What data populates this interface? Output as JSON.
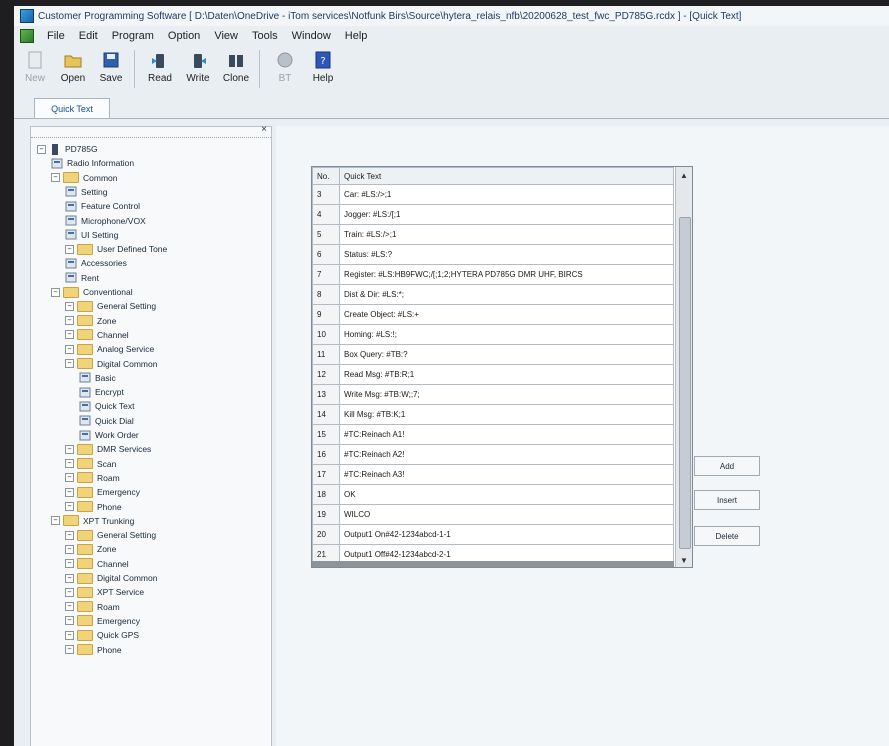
{
  "window": {
    "title": "Customer Programming Software [ D:\\Daten\\OneDrive - iTom services\\Notfunk Birs\\Source\\hytera_relais_nfb\\20200628_test_fwc_PD785G.rcdx ] - [Quick Text]"
  },
  "menu": [
    "File",
    "Edit",
    "Program",
    "Option",
    "View",
    "Tools",
    "Window",
    "Help"
  ],
  "toolbar": {
    "new": "New",
    "open": "Open",
    "save": "Save",
    "read": "Read",
    "write": "Write",
    "clone": "Clone",
    "bt": "BT",
    "help": "Help"
  },
  "tab": {
    "label": "Quick Text"
  },
  "tree": [
    {
      "label": "PD785G",
      "level": 0,
      "kind": "device"
    },
    {
      "label": "Radio Information",
      "level": 1,
      "kind": "leaf"
    },
    {
      "label": "Common",
      "level": 1,
      "kind": "folder"
    },
    {
      "label": "Setting",
      "level": 2,
      "kind": "leaf"
    },
    {
      "label": "Feature Control",
      "level": 2,
      "kind": "leaf"
    },
    {
      "label": "Microphone/VOX",
      "level": 2,
      "kind": "leaf"
    },
    {
      "label": "UI Setting",
      "level": 2,
      "kind": "leaf"
    },
    {
      "label": "User Defined Tone",
      "level": 2,
      "kind": "folder"
    },
    {
      "label": "Accessories",
      "level": 2,
      "kind": "leaf"
    },
    {
      "label": "Rent",
      "level": 2,
      "kind": "leaf"
    },
    {
      "label": "Conventional",
      "level": 1,
      "kind": "folder"
    },
    {
      "label": "General Setting",
      "level": 2,
      "kind": "folder"
    },
    {
      "label": "Zone",
      "level": 2,
      "kind": "folder"
    },
    {
      "label": "Channel",
      "level": 2,
      "kind": "folder"
    },
    {
      "label": "Analog Service",
      "level": 2,
      "kind": "folder"
    },
    {
      "label": "Digital Common",
      "level": 2,
      "kind": "folder"
    },
    {
      "label": "Basic",
      "level": 3,
      "kind": "leaf"
    },
    {
      "label": "Encrypt",
      "level": 3,
      "kind": "leaf"
    },
    {
      "label": "Quick Text",
      "level": 3,
      "kind": "leaf"
    },
    {
      "label": "Quick Dial",
      "level": 3,
      "kind": "leaf"
    },
    {
      "label": "Work Order",
      "level": 3,
      "kind": "leaf"
    },
    {
      "label": "DMR Services",
      "level": 2,
      "kind": "folder"
    },
    {
      "label": "Scan",
      "level": 2,
      "kind": "folder"
    },
    {
      "label": "Roam",
      "level": 2,
      "kind": "folder"
    },
    {
      "label": "Emergency",
      "level": 2,
      "kind": "folder"
    },
    {
      "label": "Phone",
      "level": 2,
      "kind": "folder"
    },
    {
      "label": "XPT Trunking",
      "level": 1,
      "kind": "folder"
    },
    {
      "label": "General Setting",
      "level": 2,
      "kind": "folder"
    },
    {
      "label": "Zone",
      "level": 2,
      "kind": "folder"
    },
    {
      "label": "Channel",
      "level": 2,
      "kind": "folder"
    },
    {
      "label": "Digital Common",
      "level": 2,
      "kind": "folder"
    },
    {
      "label": "XPT Service",
      "level": 2,
      "kind": "folder"
    },
    {
      "label": "Roam",
      "level": 2,
      "kind": "folder"
    },
    {
      "label": "Emergency",
      "level": 2,
      "kind": "folder"
    },
    {
      "label": "Quick GPS",
      "level": 2,
      "kind": "folder"
    },
    {
      "label": "Phone",
      "level": 2,
      "kind": "folder"
    }
  ],
  "grid": {
    "headers": [
      "No.",
      "Quick Text"
    ],
    "rows": [
      [
        "3",
        "Car: #LS:/>;1"
      ],
      [
        "4",
        "Jogger: #LS:/[;1"
      ],
      [
        "5",
        "Train: #LS:/>;1"
      ],
      [
        "6",
        "Status: #LS:?"
      ],
      [
        "7",
        "Register: #LS:HB9FWC;/[;1;2;HYTERA PD785G DMR UHF, BIRCS"
      ],
      [
        "8",
        "Dist & Dir: #LS:*;"
      ],
      [
        "9",
        "Create Object: #LS:+"
      ],
      [
        "10",
        "Homing: #LS:!;"
      ],
      [
        "11",
        "Box Query: #TB:?"
      ],
      [
        "12",
        "Read Msg: #TB:R;1"
      ],
      [
        "13",
        "Write Msg: #TB:W;;7;"
      ],
      [
        "14",
        "Kill Msg: #TB:K;1"
      ],
      [
        "15",
        "#TC:Reinach A1!"
      ],
      [
        "16",
        "#TC:Reinach A2!"
      ],
      [
        "17",
        "#TC:Reinach A3!"
      ],
      [
        "18",
        "OK"
      ],
      [
        "19",
        "WILCO"
      ],
      [
        "20",
        "Output1 On#42-1234abcd-1-1"
      ],
      [
        "21",
        "Output1 Off#42-1234abcd-2-1"
      ]
    ]
  },
  "buttons": {
    "add": "Add",
    "insert": "Insert",
    "delete": "Delete"
  }
}
